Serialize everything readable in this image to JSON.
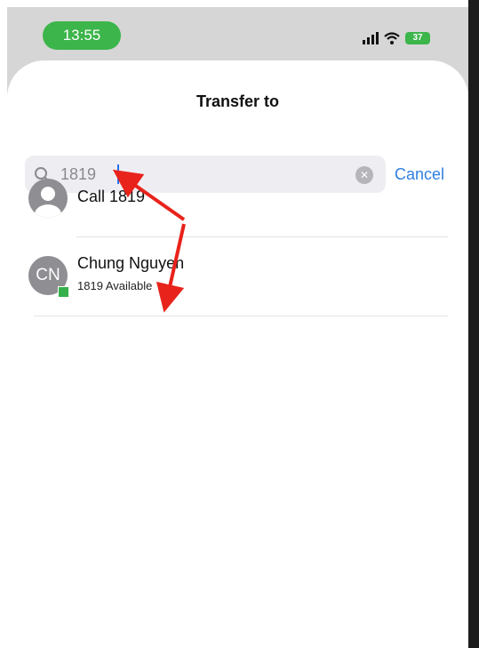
{
  "status_bar": {
    "time": "13:55",
    "battery": "37"
  },
  "sheet": {
    "title": "Transfer to"
  },
  "search": {
    "value": "1819",
    "cancel_label": "Cancel"
  },
  "results": {
    "call_label": "Call 1819",
    "contact": {
      "initials": "CN",
      "name": "Chung Nguyen",
      "status": "1819 Available"
    }
  },
  "colors": {
    "accent": "#2f7fe0",
    "presence": "#36b04a",
    "annotation": "#e8231b"
  }
}
